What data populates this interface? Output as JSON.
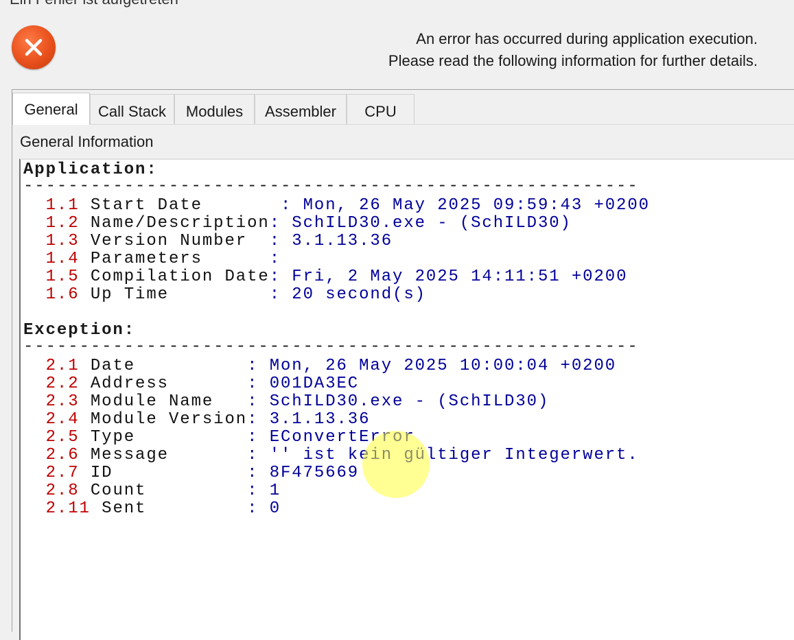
{
  "window": {
    "title": "Ein Fehler ist aufgetreten"
  },
  "message": {
    "line1": "An error has occurred during application execution.",
    "line2": "Please read the following information for further details."
  },
  "tabs": [
    {
      "label": "General"
    },
    {
      "label": "Call Stack"
    },
    {
      "label": "Modules"
    },
    {
      "label": "Assembler"
    },
    {
      "label": "CPU"
    }
  ],
  "section_label": "General Information",
  "application": {
    "header": "Application:",
    "rule": "-------------------------------------------------------",
    "rows": [
      {
        "num": "1.1",
        "key": "Start Date       ",
        "val": "Mon, 26 May 2025 09:59:43 +0200"
      },
      {
        "num": "1.2",
        "key": "Name/Description",
        "val": "SchILD30.exe - (SchILD30)"
      },
      {
        "num": "1.3",
        "key": "Version Number  ",
        "val": "3.1.13.36"
      },
      {
        "num": "1.4",
        "key": "Parameters      ",
        "val": ""
      },
      {
        "num": "1.5",
        "key": "Compilation Date",
        "val": "Fri, 2 May 2025 14:11:51 +0200"
      },
      {
        "num": "1.6",
        "key": "Up Time         ",
        "val": "20 second(s)"
      }
    ]
  },
  "exception": {
    "header": "Exception:",
    "rule": "-------------------------------------------------------",
    "rows": [
      {
        "num": "2.1",
        "key": "Date          ",
        "val": "Mon, 26 May 2025 10:00:04 +0200"
      },
      {
        "num": "2.2",
        "key": "Address       ",
        "val": "001DA3EC"
      },
      {
        "num": "2.3",
        "key": "Module Name   ",
        "val": "SchILD30.exe - (SchILD30)"
      },
      {
        "num": "2.4",
        "key": "Module Version",
        "val": "3.1.13.36"
      },
      {
        "num": "2.5",
        "key": "Type          ",
        "val": "EConvertError"
      },
      {
        "num": "2.6",
        "key": "Message       ",
        "val": "'' ist kein gültiger Integerwert."
      },
      {
        "num": "2.7",
        "key": "ID            ",
        "val": "8F475669"
      },
      {
        "num": "2.8",
        "key": "Count         ",
        "val": "1"
      },
      {
        "num": "2.11",
        "key": "Sent         ",
        "val": "0"
      }
    ]
  },
  "colors": {
    "number": "#c00000",
    "value": "#000099",
    "icon": "#e8501c"
  },
  "icons": {
    "error": "error-x-icon"
  }
}
